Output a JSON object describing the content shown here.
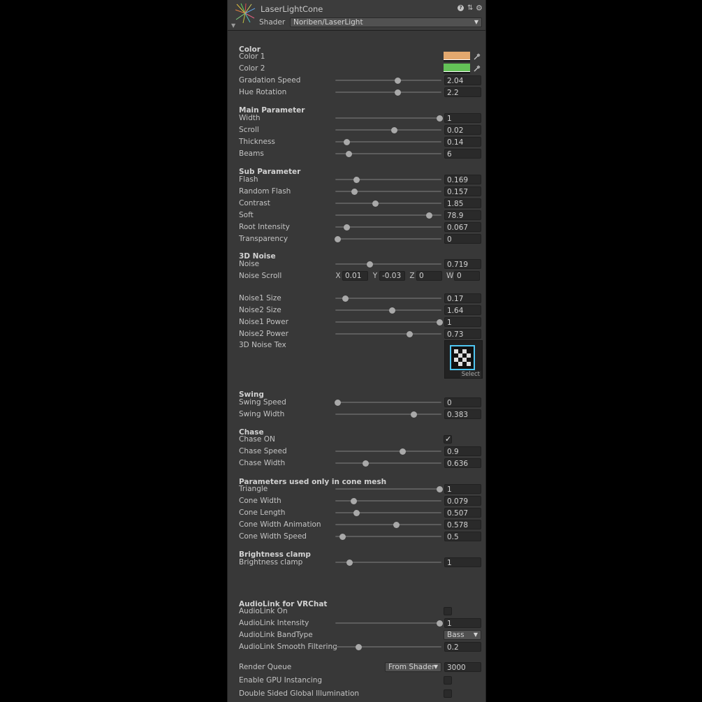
{
  "header": {
    "title": "LaserLightCone",
    "shader_label": "Shader",
    "shader_value": "Noriben/LaserLight",
    "help_icon": "help-icon",
    "settings_icon": "gear-icon"
  },
  "color_section": {
    "title": "Color",
    "color1_label": "Color 1",
    "color1_value": "#e3a86e",
    "color2_label": "Color 2",
    "color2_value": "#63c257",
    "gradation_label": "Gradation Speed",
    "gradation_value": "2.04",
    "gradation_slider": 0.59,
    "hue_label": "Hue Rotation",
    "hue_value": "2.2",
    "hue_slider": 0.595
  },
  "main_param": {
    "title": "Main Parameter",
    "rows": [
      {
        "label": "Width",
        "value": "1",
        "slider": 1.0
      },
      {
        "label": "Scroll",
        "value": "0.02",
        "slider": 0.56
      },
      {
        "label": "Thickness",
        "value": "0.14",
        "slider": 0.09
      },
      {
        "label": "Beams",
        "value": "6",
        "slider": 0.11
      }
    ]
  },
  "sub_param": {
    "title": "Sub Parameter",
    "rows": [
      {
        "label": "Flash",
        "value": "0.169",
        "slider": 0.19
      },
      {
        "label": "Random Flash",
        "value": "0.157",
        "slider": 0.17
      },
      {
        "label": "Contrast",
        "value": "1.85",
        "slider": 0.37
      },
      {
        "label": "Soft",
        "value": "78.9",
        "slider": 0.9
      },
      {
        "label": "Root Intensity",
        "value": "0.067",
        "slider": 0.09
      },
      {
        "label": "Transparency",
        "value": "0",
        "slider": 0.0
      }
    ]
  },
  "noise_section": {
    "title": "3D Noise",
    "noise_label": "Noise",
    "noise_value": "0.719",
    "noise_slider": 0.32,
    "scroll_label": "Noise Scroll",
    "scroll": {
      "x_label": "X",
      "x": "0.01",
      "y_label": "Y",
      "y": "-0.03",
      "z_label": "Z",
      "z": "0",
      "w_label": "W",
      "w": "0"
    },
    "rows": [
      {
        "label": "Noise1 Size",
        "value": "0.17",
        "slider": 0.08
      },
      {
        "label": "Noise2 Size",
        "value": "1.64",
        "slider": 0.54
      },
      {
        "label": "Noise1 Power",
        "value": "1",
        "slider": 1.0
      },
      {
        "label": "Noise2 Power",
        "value": "0.73",
        "slider": 0.71
      }
    ],
    "tex_label": "3D Noise Tex",
    "tex_select": "Select"
  },
  "swing_section": {
    "title": "Swing",
    "rows": [
      {
        "label": "Swing Speed",
        "value": "0",
        "slider": 0.0
      },
      {
        "label": "Swing Width",
        "value": "0.383",
        "slider": 0.75
      }
    ]
  },
  "chase_section": {
    "title": "Chase",
    "on_label": "Chase ON",
    "on_checked": true,
    "rows": [
      {
        "label": "Chase Speed",
        "value": "0.9",
        "slider": 0.64
      },
      {
        "label": "Chase Width",
        "value": "0.636",
        "slider": 0.28
      }
    ]
  },
  "cone_section": {
    "title": "Parameters used only in cone mesh",
    "rows": [
      {
        "label": "Triangle",
        "value": "1",
        "slider": 1.0
      },
      {
        "label": "Cone Width",
        "value": "0.079",
        "slider": 0.16
      },
      {
        "label": "Cone Length",
        "value": "0.507",
        "slider": 0.19
      },
      {
        "label": "Cone Width Animation",
        "value": "0.578",
        "slider": 0.58
      },
      {
        "label": "Cone Width Speed",
        "value": "0.5",
        "slider": 0.05
      }
    ]
  },
  "brightness_section": {
    "title": "Brightness clamp",
    "rows": [
      {
        "label": "Brightness clamp",
        "value": "1",
        "slider": 0.12
      }
    ]
  },
  "audiolink_section": {
    "title": "AudioLink for VRChat",
    "on_label": "AudioLink On",
    "on_checked": false,
    "intensity_label": "AudioLink Intensity",
    "intensity_value": "1",
    "intensity_slider": 1.0,
    "band_label": "AudioLink BandType",
    "band_value": "Bass",
    "smooth_label": "AudioLink Smooth Filtering",
    "smooth_value": "0.2",
    "smooth_slider": 0.21
  },
  "footer": {
    "render_queue_label": "Render Queue",
    "render_queue_mode": "From Shader",
    "render_queue_value": "3000",
    "gpu_label": "Enable GPU Instancing",
    "gpu_checked": false,
    "dsgi_label": "Double Sided Global Illumination",
    "dsgi_checked": false
  }
}
